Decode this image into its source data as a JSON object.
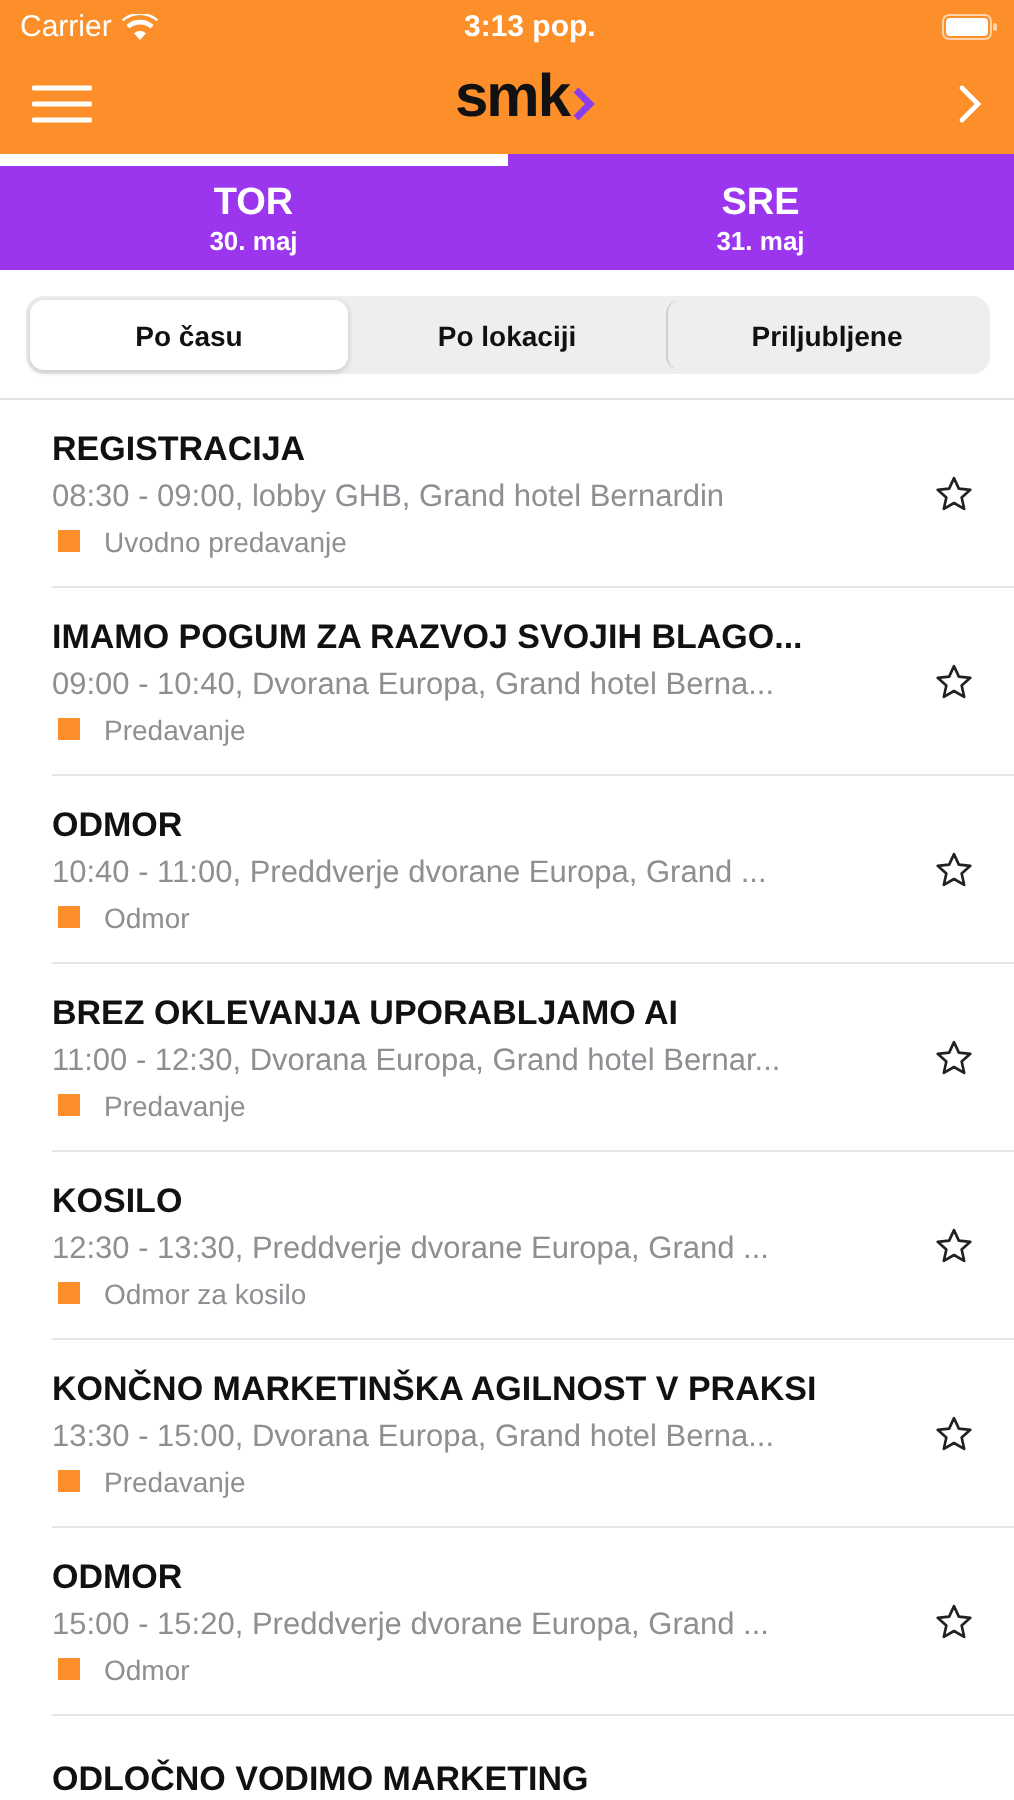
{
  "status_bar": {
    "carrier": "Carrier",
    "time": "3:13 pop."
  },
  "nav": {
    "logo": "smk"
  },
  "day_tabs": [
    {
      "day": "TOR",
      "date": "30. maj",
      "selected": true
    },
    {
      "day": "SRE",
      "date": "31. maj",
      "selected": false
    }
  ],
  "segments": [
    {
      "label": "Po času",
      "selected": true
    },
    {
      "label": "Po lokaciji",
      "selected": false
    },
    {
      "label": "Priljubljene",
      "selected": false
    }
  ],
  "sessions": [
    {
      "title": "REGISTRACIJA",
      "details": "08:30 - 09:00, lobby GHB, Grand hotel Bernardin",
      "category": "Uvodno predavanje",
      "color": "#fd8f2b",
      "favorite": false
    },
    {
      "title": "IMAMO POGUM ZA RAZVOJ SVOJIH BLAGO...",
      "details": "09:00 - 10:40, Dvorana Europa, Grand hotel Berna...",
      "category": "Predavanje",
      "color": "#fd8f2b",
      "favorite": false
    },
    {
      "title": "ODMOR",
      "details": "10:40 - 11:00, Preddverje dvorane Europa, Grand ...",
      "category": "Odmor",
      "color": "#fd8f2b",
      "favorite": false
    },
    {
      "title": "BREZ OKLEVANJA UPORABLJAMO AI",
      "details": "11:00 - 12:30, Dvorana Europa, Grand hotel Bernar...",
      "category": "Predavanje",
      "color": "#fd8f2b",
      "favorite": false
    },
    {
      "title": "KOSILO",
      "details": "12:30 - 13:30, Preddverje dvorane Europa, Grand ...",
      "category": "Odmor za kosilo",
      "color": "#fd8f2b",
      "favorite": false
    },
    {
      "title": "KONČNO MARKETINŠKA AGILNOST V PRAKSI",
      "details": "13:30 - 15:00, Dvorana Europa, Grand hotel Berna...",
      "category": "Predavanje",
      "color": "#fd8f2b",
      "favorite": false
    },
    {
      "title": "ODMOR",
      "details": "15:00 - 15:20, Preddverje dvorane Europa, Grand ...",
      "category": "Odmor",
      "color": "#fd8f2b",
      "favorite": false
    },
    {
      "title": "ODLOČNO VODIMO MARKETING"
    }
  ]
}
